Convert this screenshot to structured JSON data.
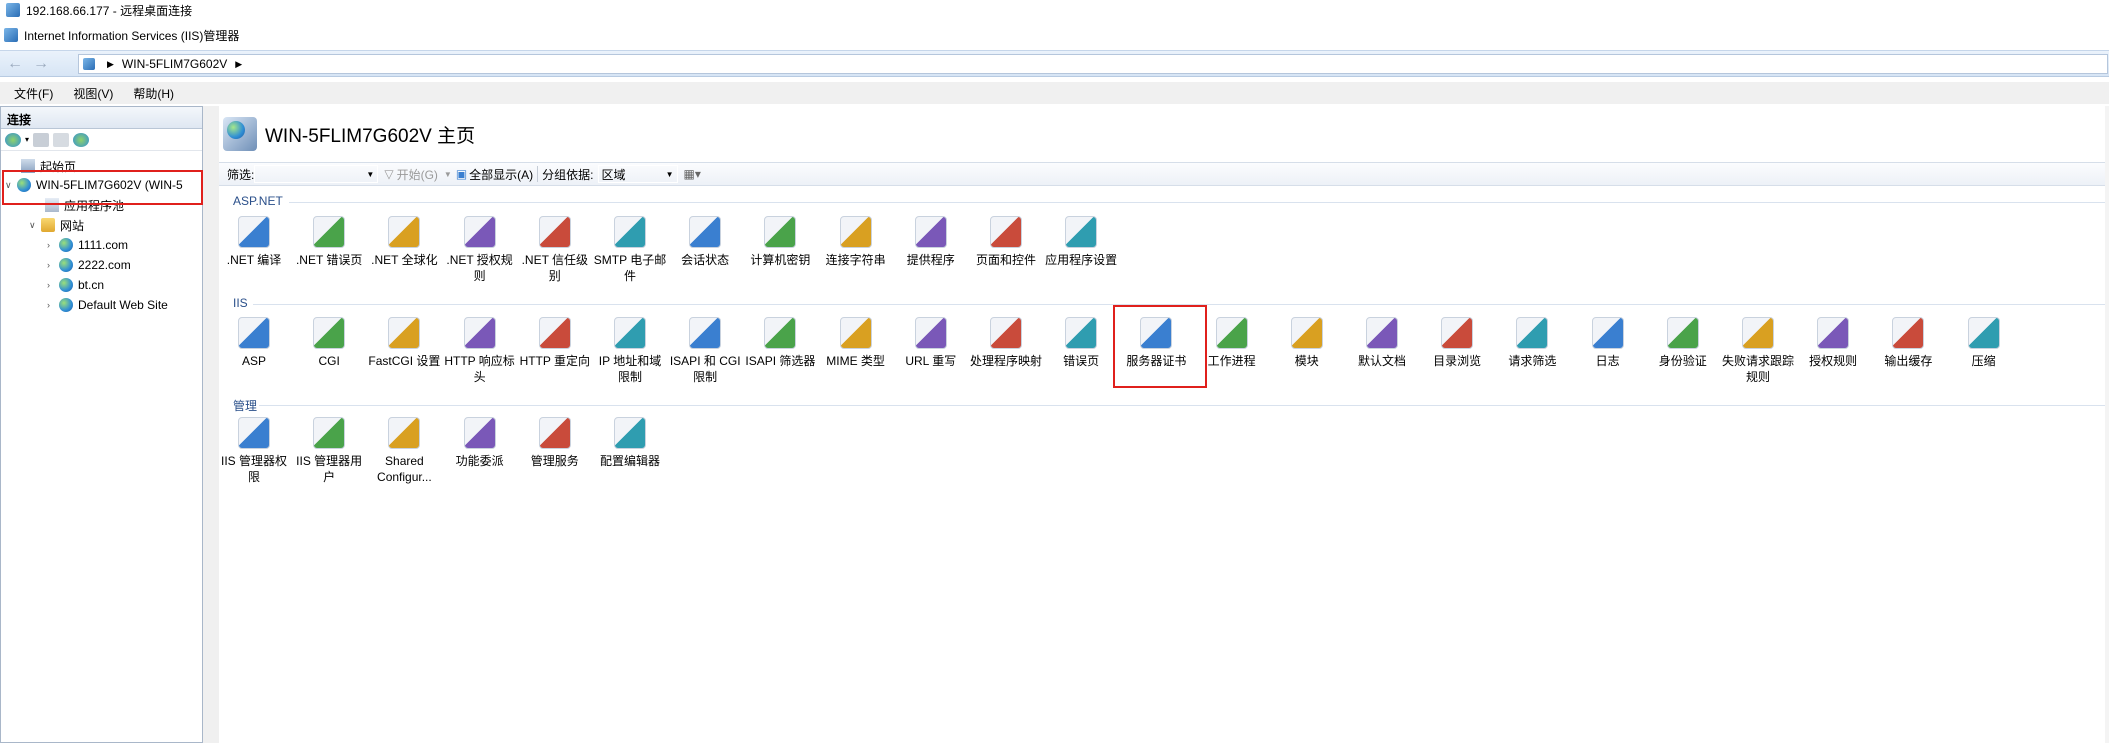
{
  "rdp_title": "192.168.66.177 - 远程桌面连接",
  "app_title": "Internet Information Services (IIS)管理器",
  "address": {
    "server": "WIN-5FLIM7G602V"
  },
  "menu": [
    "文件(F)",
    "视图(V)",
    "帮助(H)"
  ],
  "connections": {
    "header": "连接",
    "tree": [
      {
        "label": "起始页"
      },
      {
        "label": "WIN-5FLIM7G602V (WIN-5"
      },
      {
        "label": "应用程序池"
      },
      {
        "label": "网站"
      },
      {
        "label": "1111.com"
      },
      {
        "label": "2222.com"
      },
      {
        "label": "bt.cn"
      },
      {
        "label": "Default Web Site"
      }
    ]
  },
  "main": {
    "title": "WIN-5FLIM7G602V 主页",
    "filter_label": "筛选:",
    "start_label": "开始(G)",
    "show_all_label": "全部显示(A)",
    "group_label": "分组依据:",
    "group_value": "区域"
  },
  "sections": {
    "aspnet": {
      "title": "ASP.NET",
      "items": [
        ".NET 编译",
        ".NET 错误页",
        ".NET 全球化",
        ".NET 授权规则",
        ".NET 信任级别",
        "SMTP 电子邮件",
        "会话状态",
        "计算机密钥",
        "连接字符串",
        "提供程序",
        "页面和控件",
        "应用程序设置"
      ]
    },
    "iis": {
      "title": "IIS",
      "items": [
        "ASP",
        "CGI",
        "FastCGI 设置",
        "HTTP 响应标头",
        "HTTP 重定向",
        "IP 地址和域限制",
        "ISAPI 和 CGI 限制",
        "ISAPI 筛选器",
        "MIME 类型",
        "URL 重写",
        "处理程序映射",
        "错误页",
        "服务器证书",
        "工作进程",
        "模块",
        "默认文档",
        "目录浏览",
        "请求筛选",
        "日志",
        "身份验证",
        "失败请求跟踪规则",
        "授权规则",
        "输出缓存",
        "压缩"
      ]
    },
    "manage": {
      "title": "管理",
      "items": [
        "IIS 管理器权限",
        "IIS 管理器用户",
        "Shared Configur...",
        "功能委派",
        "管理服务",
        "配置编辑器"
      ]
    }
  },
  "icon_colors": [
    "#3a7fd0",
    "#4aa34a",
    "#d9a021",
    "#7a58b8",
    "#c94b3b",
    "#2f9db0"
  ]
}
